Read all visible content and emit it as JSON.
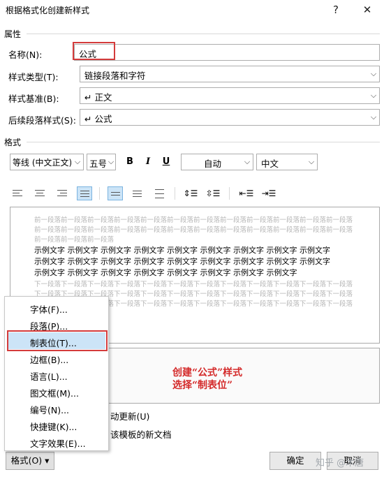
{
  "dialog": {
    "title": "根据格式化创建新样式",
    "help": "?",
    "close": "✕"
  },
  "properties": {
    "section_label": "属性",
    "name_label": "名称(N):",
    "name_value": "公式",
    "type_label": "样式类型(T):",
    "type_value": "链接段落和字符",
    "base_label": "样式基准(B):",
    "base_value": "↵ 正文",
    "next_label": "后续段落样式(S):",
    "next_value": "↵ 公式"
  },
  "format": {
    "section_label": "格式",
    "font": "等线 (中文正文)",
    "size": "五号",
    "bold": "B",
    "italic": "I",
    "underline": "U",
    "color": "自动",
    "lang": "中文"
  },
  "preview": {
    "prev_lines": [
      "前一段落前一段落前一段落前一段落前一段落前一段落前一段落前一段落前一段落前一段落前一段落前一段落",
      "前一段落前一段落前一段落前一段落前一段落前一段落前一段落前一段落前一段落前一段落前一段落前一段落",
      "前一段落前一段落前一段落"
    ],
    "sample_lines": [
      "示例文字  示例文字  示例文字  示例文字  示例文字  示例文字  示例文字  示例文字  示例文字",
      "示例文字  示例文字  示例文字  示例文字  示例文字  示例文字  示例文字  示例文字  示例文字",
      "示例文字  示例文字  示例文字  示例文字  示例文字  示例文字  示例文字  示例文字"
    ],
    "next_lines": [
      "下一段落下一段落下一段落下一段落下一段落下一段落下一段落下一段落下一段落下一段落下一段落下一段落",
      "下一段落下一段落下一段落下一段落下一段落下一段落下一段落下一段落下一段落下一段落下一段落下一段落",
      "下一段落下一段落下一段落下一段落下一段落下一段落下一段落下一段落下一段落下一段落下一段落下一段落"
    ]
  },
  "annotation": {
    "line1": "创建“公式”样式",
    "line2": "选择“制表位”"
  },
  "options": {
    "auto_update": "动更新(U)",
    "template": "该模板的新文档"
  },
  "menu": {
    "items": [
      "字体(F)...",
      "段落(P)...",
      "制表位(T)...",
      "边框(B)...",
      "语言(L)...",
      "图文框(M)...",
      "编号(N)...",
      "快捷键(K)...",
      "文字效果(E)..."
    ],
    "selected_index": 2
  },
  "buttons": {
    "format": "格式(O) ▾",
    "ok": "确定",
    "cancel": "取消"
  },
  "watermark": "知乎 @木唐",
  "colors": {
    "highlight_red": "#d43b3b",
    "annotation_red": "#d42a2a",
    "selected_blue": "#cce4f7"
  }
}
